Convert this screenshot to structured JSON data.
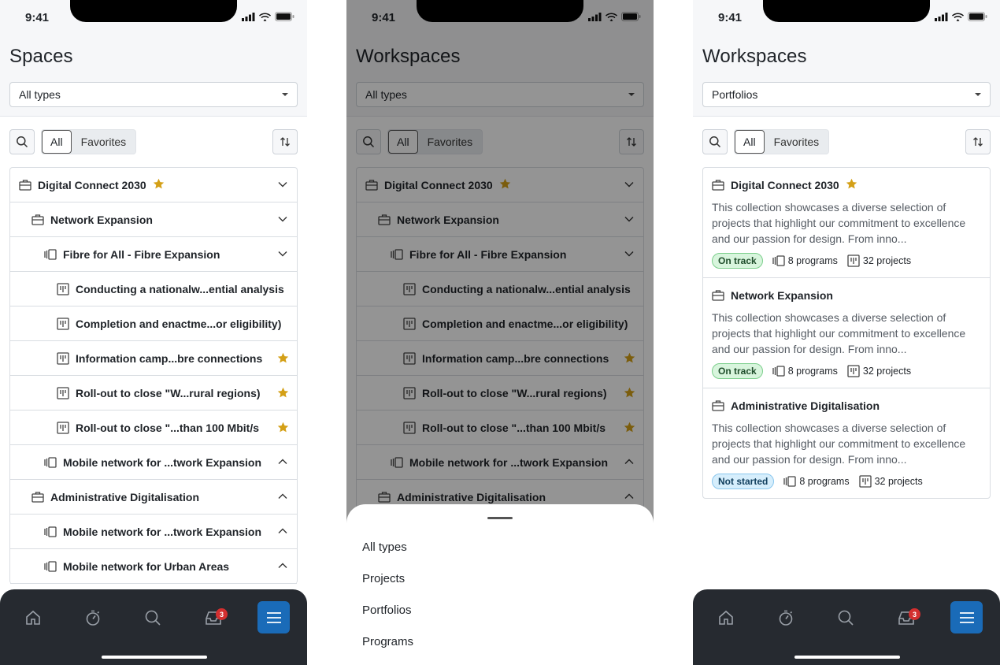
{
  "status": {
    "time": "9:41"
  },
  "screen1": {
    "title": "Spaces",
    "filter": "All types",
    "segments": {
      "all": "All",
      "favorites": "Favorites"
    },
    "tree": [
      {
        "label": "Digital Connect 2030",
        "level": 0,
        "kind": "portfolio",
        "star": true,
        "chevron": "down"
      },
      {
        "label": "Network Expansion",
        "level": 1,
        "kind": "portfolio",
        "star": false,
        "chevron": "down"
      },
      {
        "label": "Fibre for All - Fibre Expansion",
        "level": 2,
        "kind": "program",
        "star": false,
        "chevron": "down"
      },
      {
        "label": "Conducting a nationalw...ential analysis",
        "level": 3,
        "kind": "project",
        "star": false,
        "chevron": ""
      },
      {
        "label": "Completion and enactme...or eligibility)",
        "level": 3,
        "kind": "project",
        "star": false,
        "chevron": ""
      },
      {
        "label": "Information camp...bre connections",
        "level": 3,
        "kind": "project",
        "star": true,
        "chevron": ""
      },
      {
        "label": "Roll-out to close \"W...rural regions)",
        "level": 3,
        "kind": "project",
        "star": true,
        "chevron": ""
      },
      {
        "label": "Roll-out to close \"...than 100 Mbit/s",
        "level": 3,
        "kind": "project",
        "star": true,
        "chevron": ""
      },
      {
        "label": "Mobile network for ...twork Expansion",
        "level": 2,
        "kind": "program",
        "star": false,
        "chevron": "up"
      },
      {
        "label": "Administrative Digitalisation",
        "level": 1,
        "kind": "portfolio",
        "star": false,
        "chevron": "up"
      },
      {
        "label": "Mobile network for ...twork Expansion",
        "level": 2,
        "kind": "program",
        "star": false,
        "chevron": "up"
      },
      {
        "label": "Mobile network for Urban Areas",
        "level": 2,
        "kind": "program",
        "star": false,
        "chevron": "up"
      }
    ]
  },
  "screen2": {
    "title": "Workspaces",
    "filter": "All types",
    "segments": {
      "all": "All",
      "favorites": "Favorites"
    },
    "sheet_options": [
      "All types",
      "Projects",
      "Portfolios",
      "Programs"
    ]
  },
  "screen3": {
    "title": "Workspaces",
    "filter": "Portfolios",
    "segments": {
      "all": "All",
      "favorites": "Favorites"
    },
    "cards": [
      {
        "title": "Digital Connect 2030",
        "star": true,
        "description": "This collection showcases a diverse selection of projects that highlight our commitment to excellence and our passion for design. From inno...",
        "status": "On track",
        "status_kind": "ontrack",
        "programs": "8 programs",
        "projects": "32 projects"
      },
      {
        "title": "Network Expansion",
        "star": false,
        "description": "This collection showcases a diverse selection of projects that highlight our commitment to excellence and our passion for design. From inno...",
        "status": "On track",
        "status_kind": "ontrack",
        "programs": "8 programs",
        "projects": "32 projects"
      },
      {
        "title": "Administrative Digitalisation",
        "star": false,
        "description": "This collection showcases a diverse selection of projects that highlight our commitment to excellence and our passion for design. From inno...",
        "status": "Not started",
        "status_kind": "notstarted",
        "programs": "8 programs",
        "projects": "32 projects"
      }
    ]
  },
  "nav": {
    "inbox_badge": "3",
    "items": [
      "home-icon",
      "timer-icon",
      "search-icon",
      "inbox-icon",
      "menu-icon"
    ]
  },
  "colors": {
    "accent": "#1a6bb8",
    "star": "#d4a017",
    "ontrack": "#d8f5dd",
    "notstarted": "#d6eefc",
    "nav": "#262a30"
  }
}
